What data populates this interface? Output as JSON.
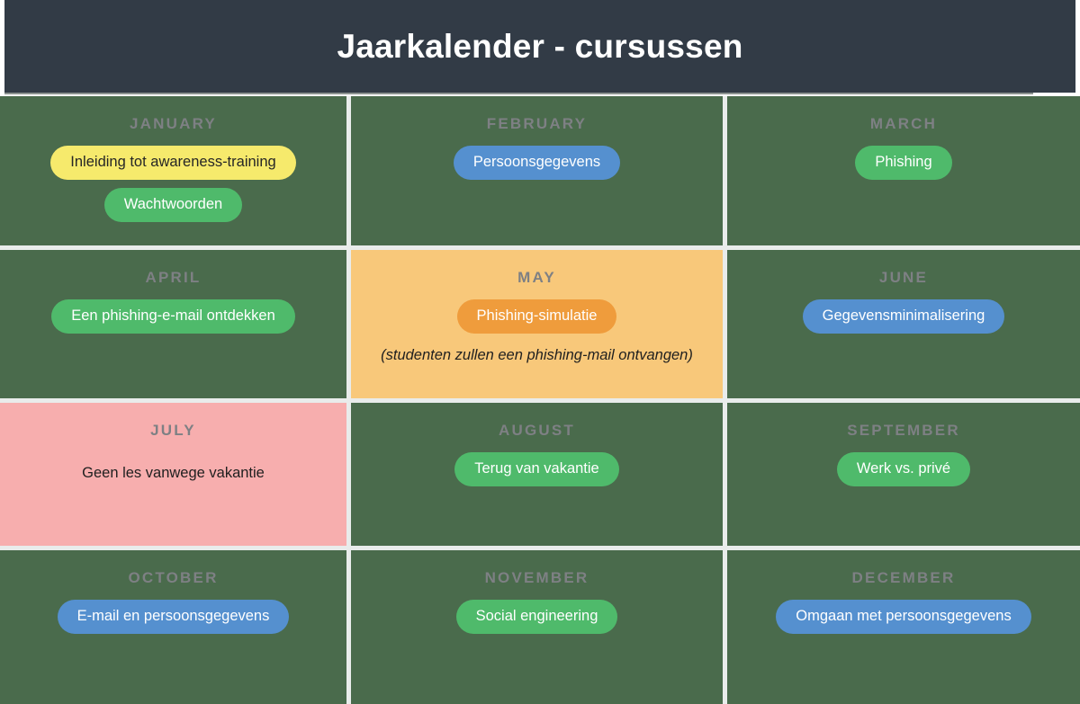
{
  "header": {
    "title": "Jaarkalender - cursussen"
  },
  "colors": {
    "header_background": "#323b46",
    "cell_background": "#4a6b4c",
    "grid_line": "#e9eceb",
    "month_label": "#7e8084",
    "pill_green": "#4fba6b",
    "pill_blue": "#5590cf",
    "pill_yellow": "#f6ea6c",
    "pill_orange": "#ef9c3c",
    "highlight_orange": "#f8c87a",
    "highlight_pink": "#f7aeae"
  },
  "months": [
    {
      "name": "JANUARY",
      "cell_style": "default",
      "pills": [
        {
          "label": "Inleiding tot awareness-training",
          "color": "yellow"
        },
        {
          "label": "Wachtwoorden",
          "color": "green"
        }
      ],
      "note": ""
    },
    {
      "name": "FEBRUARY",
      "cell_style": "default",
      "pills": [
        {
          "label": "Persoonsgegevens",
          "color": "blue"
        }
      ],
      "note": ""
    },
    {
      "name": "MARCH",
      "cell_style": "default",
      "pills": [
        {
          "label": "Phishing",
          "color": "green"
        }
      ],
      "note": ""
    },
    {
      "name": "APRIL",
      "cell_style": "default",
      "pills": [
        {
          "label": "Een phishing-e-mail ontdekken",
          "color": "green"
        }
      ],
      "note": ""
    },
    {
      "name": "MAY",
      "cell_style": "highlight-orange",
      "pills": [
        {
          "label": "Phishing-simulatie",
          "color": "orange"
        }
      ],
      "note": "(studenten zullen een phishing-mail ontvangen)",
      "note_style": "italic"
    },
    {
      "name": "JUNE",
      "cell_style": "default",
      "pills": [
        {
          "label": "Gegevensminimalisering",
          "color": "blue"
        }
      ],
      "note": ""
    },
    {
      "name": "JULY",
      "cell_style": "highlight-pink",
      "pills": [],
      "note": "Geen les vanwege vakantie",
      "note_style": "plain"
    },
    {
      "name": "AUGUST",
      "cell_style": "default",
      "pills": [
        {
          "label": "Terug van vakantie",
          "color": "green"
        }
      ],
      "note": ""
    },
    {
      "name": "SEPTEMBER",
      "cell_style": "default",
      "pills": [
        {
          "label": "Werk vs. privé",
          "color": "green"
        }
      ],
      "note": ""
    },
    {
      "name": "OCTOBER",
      "cell_style": "default",
      "pills": [
        {
          "label": "E-mail en persoonsgegevens",
          "color": "blue"
        }
      ],
      "note": ""
    },
    {
      "name": "NOVEMBER",
      "cell_style": "default",
      "pills": [
        {
          "label": "Social engineering",
          "color": "green"
        }
      ],
      "note": ""
    },
    {
      "name": "DECEMBER",
      "cell_style": "default",
      "pills": [
        {
          "label": "Omgaan met persoonsgegevens",
          "color": "blue"
        }
      ],
      "note": ""
    }
  ]
}
